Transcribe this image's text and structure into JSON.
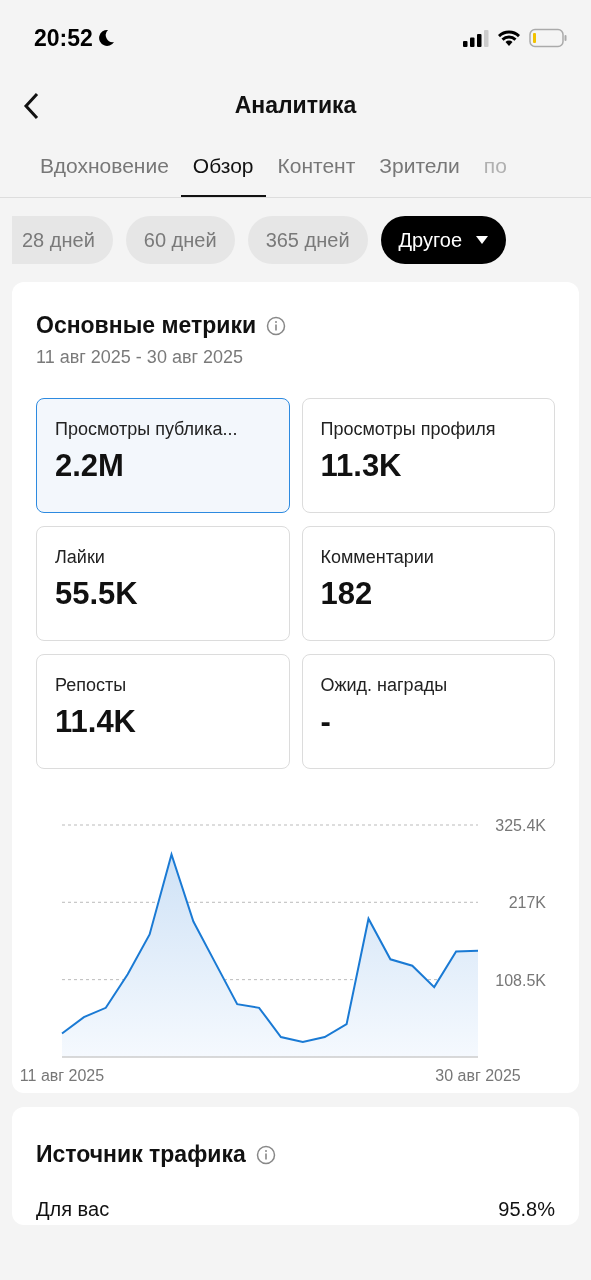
{
  "status_bar": {
    "time": "20:52"
  },
  "header": {
    "title": "Аналитика"
  },
  "tabs": [
    {
      "label": "Вдохновение",
      "selected": false
    },
    {
      "label": "Обзор",
      "selected": true
    },
    {
      "label": "Контент",
      "selected": false
    },
    {
      "label": "Зрители",
      "selected": false
    },
    {
      "label": "по",
      "selected": false
    }
  ],
  "periods": [
    {
      "label": "28 дней",
      "selected": false
    },
    {
      "label": "60 дней",
      "selected": false
    },
    {
      "label": "365 дней",
      "selected": false
    },
    {
      "label": "Другое",
      "selected": true,
      "dropdown": true
    }
  ],
  "key_metrics": {
    "title": "Основные метрики",
    "date_range": "11 авг 2025 - 30 авг 2025",
    "metrics": [
      {
        "label": "Просмотры публика...",
        "value": "2.2M",
        "selected": true
      },
      {
        "label": "Просмотры профиля",
        "value": "11.3K",
        "selected": false
      },
      {
        "label": "Лайки",
        "value": "55.5K",
        "selected": false
      },
      {
        "label": "Комментарии",
        "value": "182",
        "selected": false
      },
      {
        "label": "Репосты",
        "value": "11.4K",
        "selected": false
      },
      {
        "label": "Ожид. награды",
        "value": "-",
        "selected": false
      }
    ],
    "chart_data": {
      "type": "area",
      "categories": [
        "11 авг 2025",
        null,
        null,
        null,
        null,
        null,
        null,
        null,
        null,
        null,
        null,
        null,
        null,
        null,
        null,
        null,
        null,
        null,
        null,
        "30 авг 2025"
      ],
      "series": [
        {
          "color": "#1a7ad4",
          "values": [
            33000,
            56000,
            69000,
            116000,
            172000,
            284000,
            190000,
            132000,
            74000,
            69000,
            28000,
            21000,
            28000,
            46000,
            194000,
            137000,
            128000,
            98000,
            148000,
            149000
          ]
        }
      ],
      "ylim": [
        0,
        325400
      ],
      "yticks": [
        {
          "value": 108500,
          "label": "108.5K"
        },
        {
          "value": 217000,
          "label": "217K"
        },
        {
          "value": 325400,
          "label": "325.4K"
        }
      ]
    }
  },
  "traffic_source": {
    "title": "Источник трафика",
    "rows": [
      {
        "label": "Для вас",
        "value": "95.8%"
      }
    ]
  }
}
